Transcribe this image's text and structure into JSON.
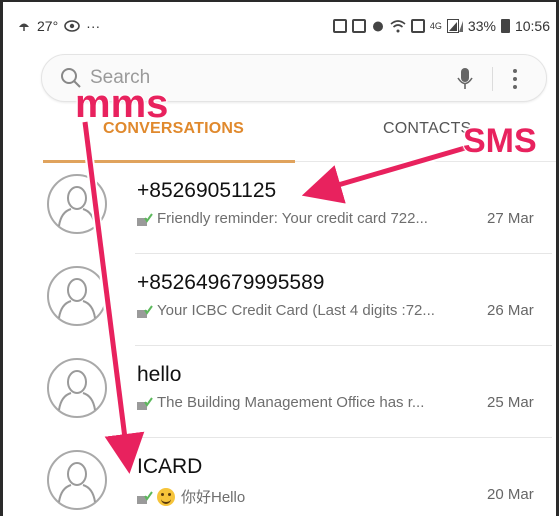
{
  "status_bar": {
    "temperature": "27°",
    "ellipsis": "···",
    "network_type": "4G",
    "battery": "33%",
    "time": "10:56"
  },
  "search": {
    "placeholder": "Search"
  },
  "tabs": [
    {
      "label": "CONVERSATIONS",
      "active": true
    },
    {
      "label": "CONTACTS",
      "active": false
    }
  ],
  "conversations": [
    {
      "name": "+85269051125",
      "preview": "Friendly reminder: Your credit card 722...",
      "date": "27 Mar"
    },
    {
      "name": "+852649679995589",
      "preview": "Your ICBC Credit Card (Last 4 digits :72...",
      "date": "26 Mar"
    },
    {
      "name": "hello",
      "preview": "The Building Management Office has r...",
      "date": "25 Mar"
    },
    {
      "name": "ICARD",
      "preview": "你好Hello",
      "date": "20 Mar"
    }
  ],
  "annotations": {
    "mms": "mms",
    "sms": "SMS"
  },
  "colors": {
    "accent": "#e0892d",
    "annotation": "#e8225e"
  },
  "icons": [
    "weather-icon",
    "eye-icon",
    "search-icon",
    "mic-icon",
    "more-vert-icon",
    "avatar-icon",
    "message-status-icon",
    "emoji-icon"
  ]
}
